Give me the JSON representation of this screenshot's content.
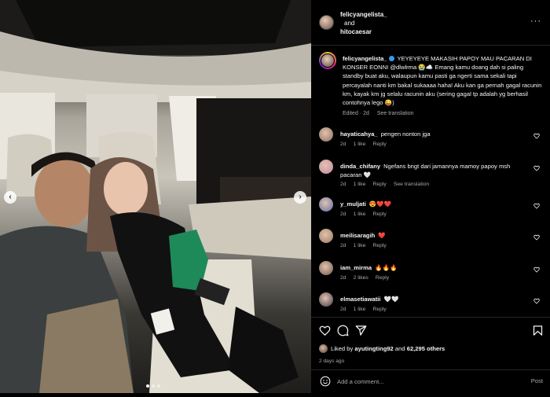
{
  "header": {
    "user1": "felicyangelista_",
    "and": "and",
    "user2": "hitocaesar",
    "more": "···"
  },
  "caption": {
    "username": "felicyangelista_",
    "text": "YEYEYEYE MAKASIH PAPOY MAU PACARAN DI KONSER EONNI @dlwlrma 😭☁️ Emang kamu doang dah si paling standby buat aku, walaupun kamu pasti ga ngerti sama sekali tapi percayalah nanti km bakal sukaaaa haha! Aku kan ga pernah gagal racunin km, kayak km jg selalu racunin aku (sering gagal tp adalah yg berhasil contohnya lego 😜)",
    "edited": "Edited · 2d",
    "see_translation": "See translation"
  },
  "comments": [
    {
      "username": "hayaticahya_",
      "text": "pengen nonton jga",
      "time": "2d",
      "likes": "1 like",
      "reply": "Reply",
      "translation": "",
      "avatar": "#8a6e5c"
    },
    {
      "username": "dinda_chifany",
      "text": "Ngefans bngt dari jamannya mamoy papoy msh pacaran 🤍",
      "time": "2d",
      "likes": "1 like",
      "reply": "Reply",
      "translation": "See translation",
      "avatar": "#c48aa6"
    },
    {
      "username": "y_muljati",
      "text": "😍❤️❤️",
      "time": "2d",
      "likes": "1 like",
      "reply": "Reply",
      "translation": "",
      "avatar": "#5a6fa8"
    },
    {
      "username": "meilisaragih",
      "text": "❤️",
      "time": "2d",
      "likes": "1 like",
      "reply": "Reply",
      "translation": "",
      "avatar": "#9a7a60"
    },
    {
      "username": "iam_mirma",
      "text": "🔥🔥🔥",
      "time": "2d",
      "likes": "2 likes",
      "reply": "Reply",
      "translation": "",
      "avatar": "#6f5a4e"
    },
    {
      "username": "elmasetiawatii",
      "text": "🤍🤍",
      "time": "2d",
      "likes": "1 like",
      "reply": "Reply",
      "translation": "",
      "avatar": "#3e3a48"
    }
  ],
  "likes": {
    "prefix": "Liked by ",
    "user": "ayutingting92",
    "middle": " and ",
    "count": "62,295 others"
  },
  "posted": "2 days ago",
  "add_comment": {
    "placeholder": "Add a comment...",
    "post_label": "Post"
  },
  "icons": [
    "heart-icon",
    "comment-icon",
    "share-icon",
    "bookmark-icon",
    "emoji-icon",
    "more-icon",
    "chevron-left-icon",
    "chevron-right-icon"
  ],
  "colors": {
    "background": "#000000",
    "text": "#f5f5f5",
    "muted": "#a8a8a8",
    "verified": "#3897f0",
    "divider": "#262626"
  }
}
